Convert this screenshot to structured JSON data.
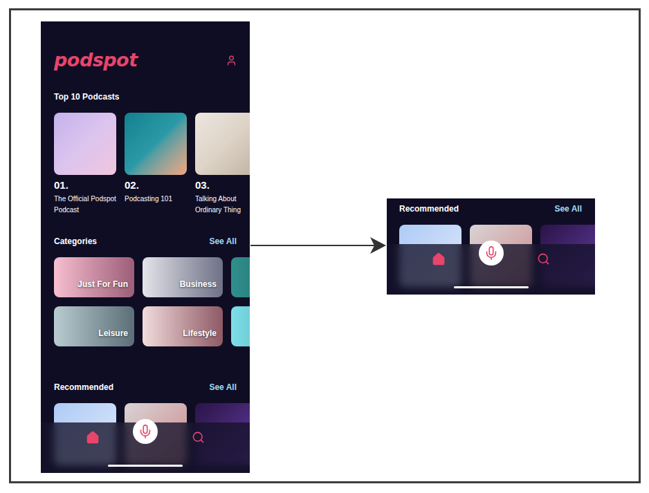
{
  "logo": "podspot",
  "top_podcasts": {
    "title": "Top 10 Podcasts",
    "items": [
      {
        "rank": "01.",
        "title": "The Official Podspot Podcast"
      },
      {
        "rank": "02.",
        "title": "Podcasting 101"
      },
      {
        "rank": "03.",
        "title": "Talking About Ordinary Thing"
      }
    ]
  },
  "categories": {
    "title": "Categories",
    "see_all": "See All",
    "items": [
      {
        "label": "Just For Fun"
      },
      {
        "label": "Business"
      },
      {
        "label": ""
      },
      {
        "label": "Leisure"
      },
      {
        "label": "Lifestyle"
      },
      {
        "label": ""
      }
    ]
  },
  "recommended": {
    "title": "Recommended",
    "see_all": "See All"
  },
  "nav": [
    {
      "kind": "home",
      "selected": true
    },
    {
      "kind": "mic",
      "selected": false
    },
    {
      "kind": "search",
      "selected": false
    }
  ],
  "zoom": {
    "title": "Recommended",
    "see_all": "See All",
    "nav": [
      {
        "kind": "home",
        "selected": true
      },
      {
        "kind": "mic",
        "selected": false
      },
      {
        "kind": "search",
        "selected": false
      }
    ]
  }
}
